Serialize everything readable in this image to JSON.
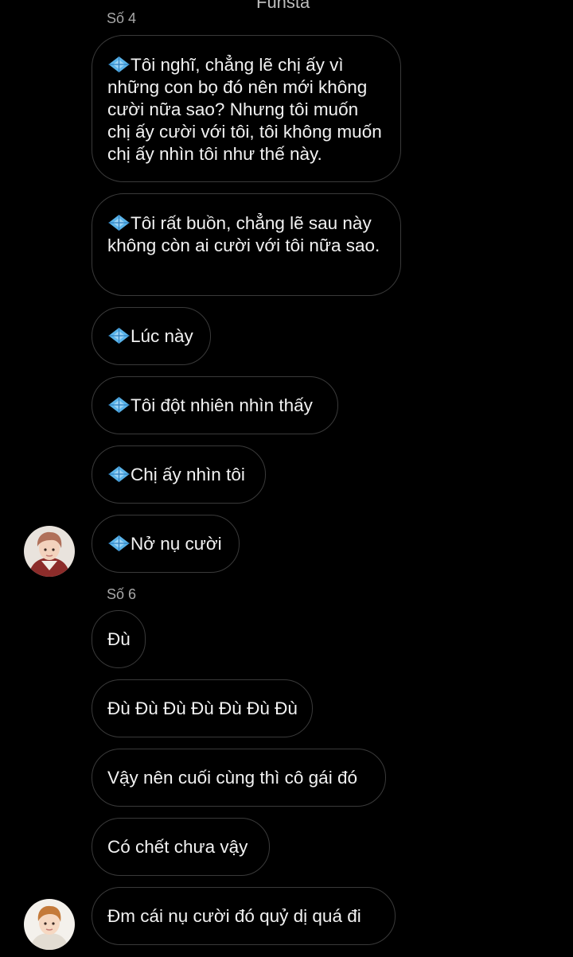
{
  "header": {
    "title": "Funsta"
  },
  "groups": [
    {
      "sender": "Số 4",
      "messages": [
        "💠Tôi nghĩ, chẳng lẽ chị ấy vì những con bọ đó nên mới không cười nữa sao? Nhưng tôi muốn chị ấy cười với tôi, tôi không muốn chị ấy nhìn tôi như thế này.",
        "💠Tôi rất buồn, chẳng lẽ sau này không còn ai cười với tôi nữa sao.",
        "💠Lúc này",
        "💠Tôi đột nhiên nhìn thấy",
        "💠Chị ấy nhìn tôi",
        "💠Nở nụ cười"
      ]
    },
    {
      "sender": "Số 6",
      "messages": [
        "Đù",
        "Đù Đù Đù Đù Đù Đù Đù",
        "Vậy nên cuối cùng thì cô gái đó",
        "Có chết chưa vậy",
        "Đm cái nụ cười đó quỷ dị quá đi"
      ]
    }
  ],
  "icons": {
    "bullet": "diamond-icon",
    "avatar": "avatar-photo"
  },
  "colors": {
    "background": "#000000",
    "bubble_border": "#3a3a3a",
    "text": "#f2f2f2",
    "sender_label": "#a8a8a8",
    "diamond": "#5ab4ea"
  }
}
